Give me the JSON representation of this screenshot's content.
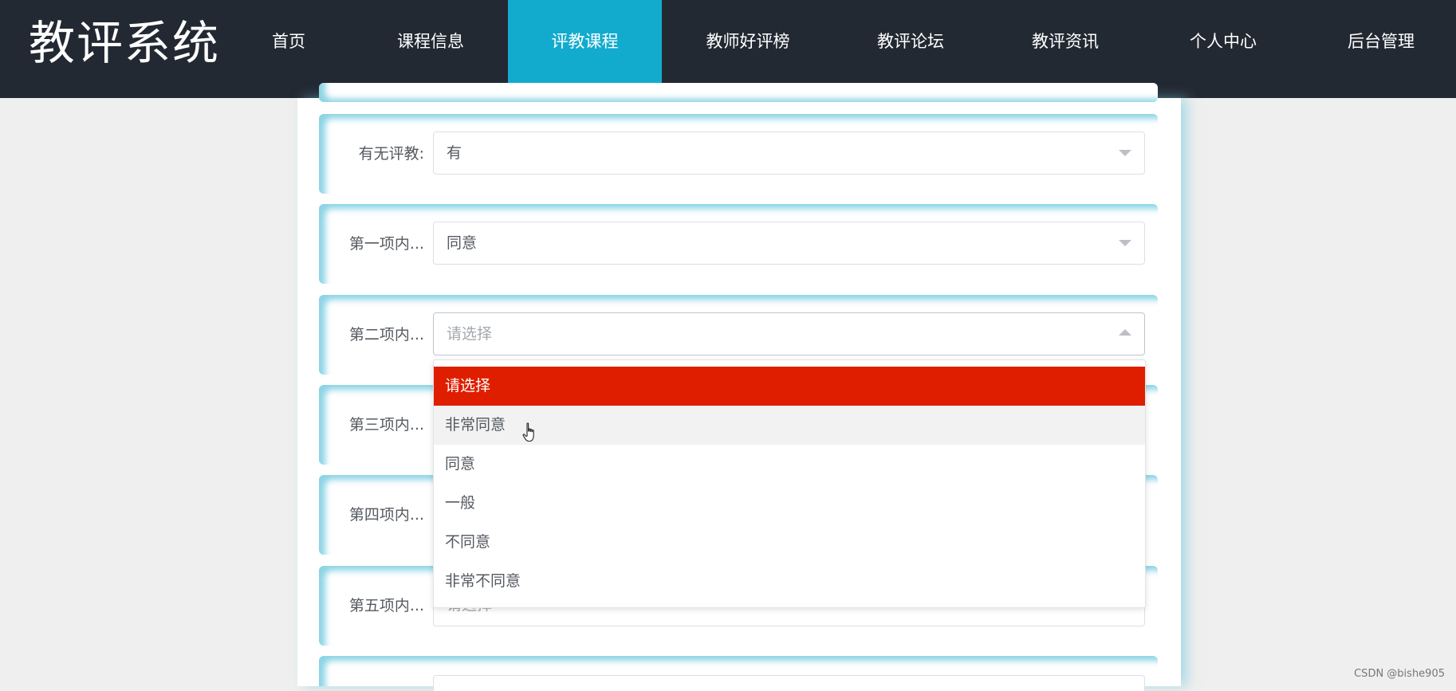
{
  "brand": "教评系统",
  "nav": {
    "items": [
      {
        "label": "首页"
      },
      {
        "label": "课程信息"
      },
      {
        "label": "评教课程",
        "active": true
      },
      {
        "label": "教师好评榜"
      },
      {
        "label": "教评论坛"
      },
      {
        "label": "教评资讯"
      },
      {
        "label": "个人中心"
      },
      {
        "label": "后台管理"
      }
    ]
  },
  "form": {
    "rows": [
      {
        "label": "有无评教:",
        "value": "有",
        "placeholder": false,
        "open": false
      },
      {
        "label": "第一项内...",
        "value": "同意",
        "placeholder": false,
        "open": false
      },
      {
        "label": "第二项内...",
        "value": "请选择",
        "placeholder": true,
        "open": true
      },
      {
        "label": "第三项内...",
        "value": "",
        "placeholder": false,
        "open": false
      },
      {
        "label": "第四项内...",
        "value": "",
        "placeholder": false,
        "open": false
      },
      {
        "label": "第五项内...",
        "value": "请选择",
        "placeholder": true,
        "open": false
      }
    ]
  },
  "dropdown": {
    "options": [
      {
        "label": "请选择",
        "state": "selected"
      },
      {
        "label": "非常同意",
        "state": "hover"
      },
      {
        "label": "同意",
        "state": ""
      },
      {
        "label": "一般",
        "state": ""
      },
      {
        "label": "不同意",
        "state": ""
      },
      {
        "label": "非常不同意",
        "state": ""
      }
    ]
  },
  "colors": {
    "header_bg": "#232933",
    "nav_active": "#12abce",
    "option_selected": "#df1e00",
    "row_glow": "#78cde1"
  },
  "watermark": "CSDN @bishe905"
}
